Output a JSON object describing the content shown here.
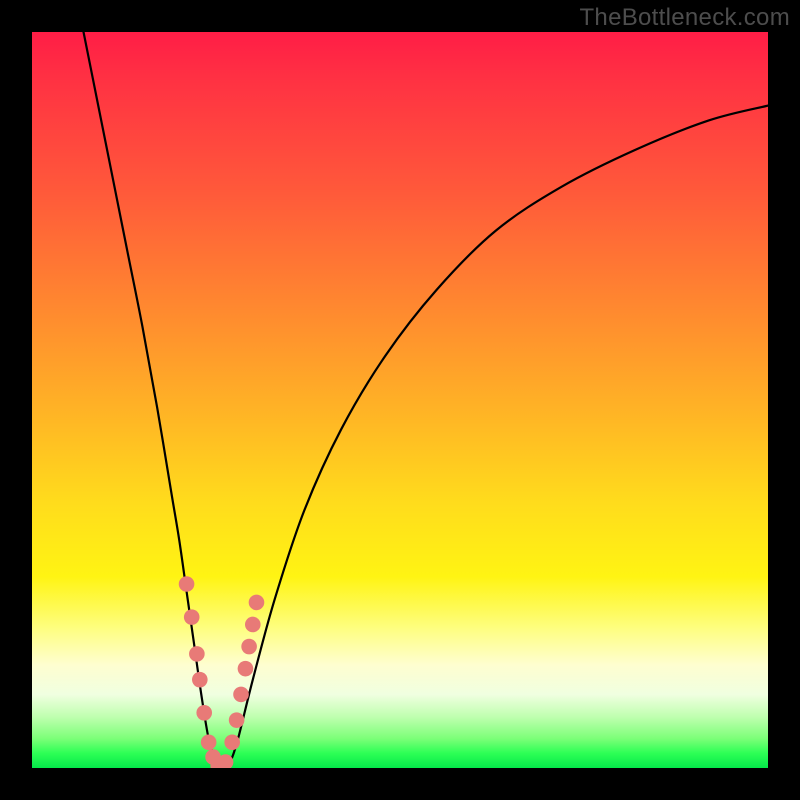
{
  "watermark": "TheBottleneck.com",
  "chart_data": {
    "type": "line",
    "title": "",
    "xlabel": "",
    "ylabel": "",
    "xlim": [
      0,
      100
    ],
    "ylim": [
      0,
      100
    ],
    "grid": false,
    "legend": false,
    "series": [
      {
        "name": "bottleneck-curve",
        "x": [
          7,
          9,
          11,
          13,
          15,
          17,
          19,
          20,
          21,
          22,
          23,
          24,
          25,
          26,
          27,
          28,
          30,
          33,
          37,
          42,
          48,
          55,
          63,
          72,
          82,
          92,
          100
        ],
        "values": [
          100,
          90,
          80,
          70,
          60,
          49,
          37,
          31,
          24,
          17,
          10,
          4,
          1,
          0,
          1,
          4,
          12,
          23,
          35,
          46,
          56,
          65,
          73,
          79,
          84,
          88,
          90
        ]
      }
    ],
    "markers": {
      "name": "highlight-points",
      "color": "#e87a77",
      "x": [
        21.0,
        21.7,
        22.4,
        22.8,
        23.4,
        24.0,
        24.6,
        25.3,
        26.3,
        27.2,
        27.8,
        28.4,
        29.0,
        29.5,
        30.0,
        30.5
      ],
      "values": [
        25.0,
        20.5,
        15.5,
        12.0,
        7.5,
        3.5,
        1.5,
        0.3,
        0.8,
        3.5,
        6.5,
        10.0,
        13.5,
        16.5,
        19.5,
        22.5
      ]
    },
    "gradient_stops": [
      {
        "pos": 0.0,
        "color": "#ff1d46"
      },
      {
        "pos": 0.22,
        "color": "#ff5a3a"
      },
      {
        "pos": 0.52,
        "color": "#ffb525"
      },
      {
        "pos": 0.74,
        "color": "#fff413"
      },
      {
        "pos": 0.9,
        "color": "#f0ffe0"
      },
      {
        "pos": 1.0,
        "color": "#05e84a"
      }
    ]
  }
}
